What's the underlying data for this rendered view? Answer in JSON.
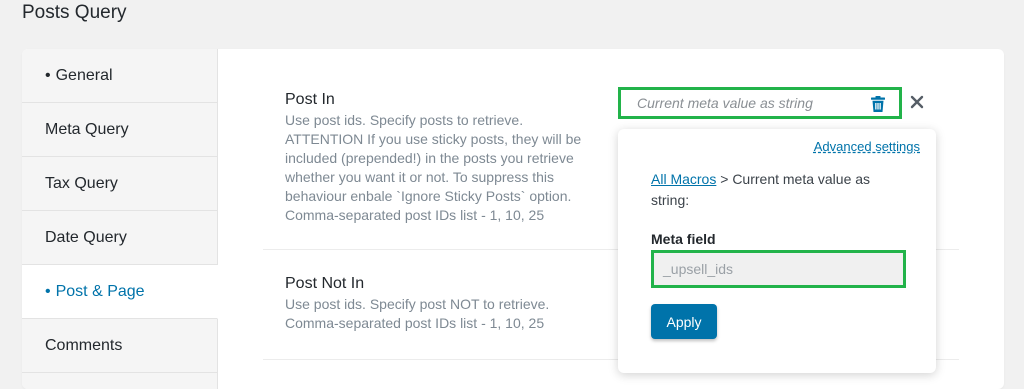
{
  "page": {
    "title": "Posts Query"
  },
  "tabs": [
    {
      "label": "General",
      "bullet": "•"
    },
    {
      "label": "Meta Query",
      "bullet": ""
    },
    {
      "label": "Tax Query",
      "bullet": ""
    },
    {
      "label": "Date Query",
      "bullet": ""
    },
    {
      "label": "Post & Page",
      "bullet": "•"
    },
    {
      "label": "Comments",
      "bullet": ""
    }
  ],
  "active_tab": "Post & Page",
  "post_in": {
    "title": "Post In",
    "description": "Use post ids. Specify posts to retrieve. ATTENTION If you use sticky posts, they will be included (prepended!) in the posts you retrieve whether you want it or not. To suppress this behaviour enbale `Ignore Sticky Posts` option. Comma-separated post IDs list - 1, 10, 25",
    "value_placeholder": "Current meta value as string"
  },
  "post_not_in": {
    "title": "Post Not In",
    "description": "Use post ids. Specify post NOT to retrieve. Comma-separated post IDs list - 1, 10, 25"
  },
  "popover": {
    "advanced_settings": "Advanced settings",
    "macros_link": "All Macros",
    "macros_path": " > Current meta value as string:",
    "field_label": "Meta field",
    "field_value": "_upsell_ids",
    "apply_label": "Apply"
  },
  "colors": {
    "accent": "#0073aa",
    "highlight_border": "#22b34a"
  }
}
